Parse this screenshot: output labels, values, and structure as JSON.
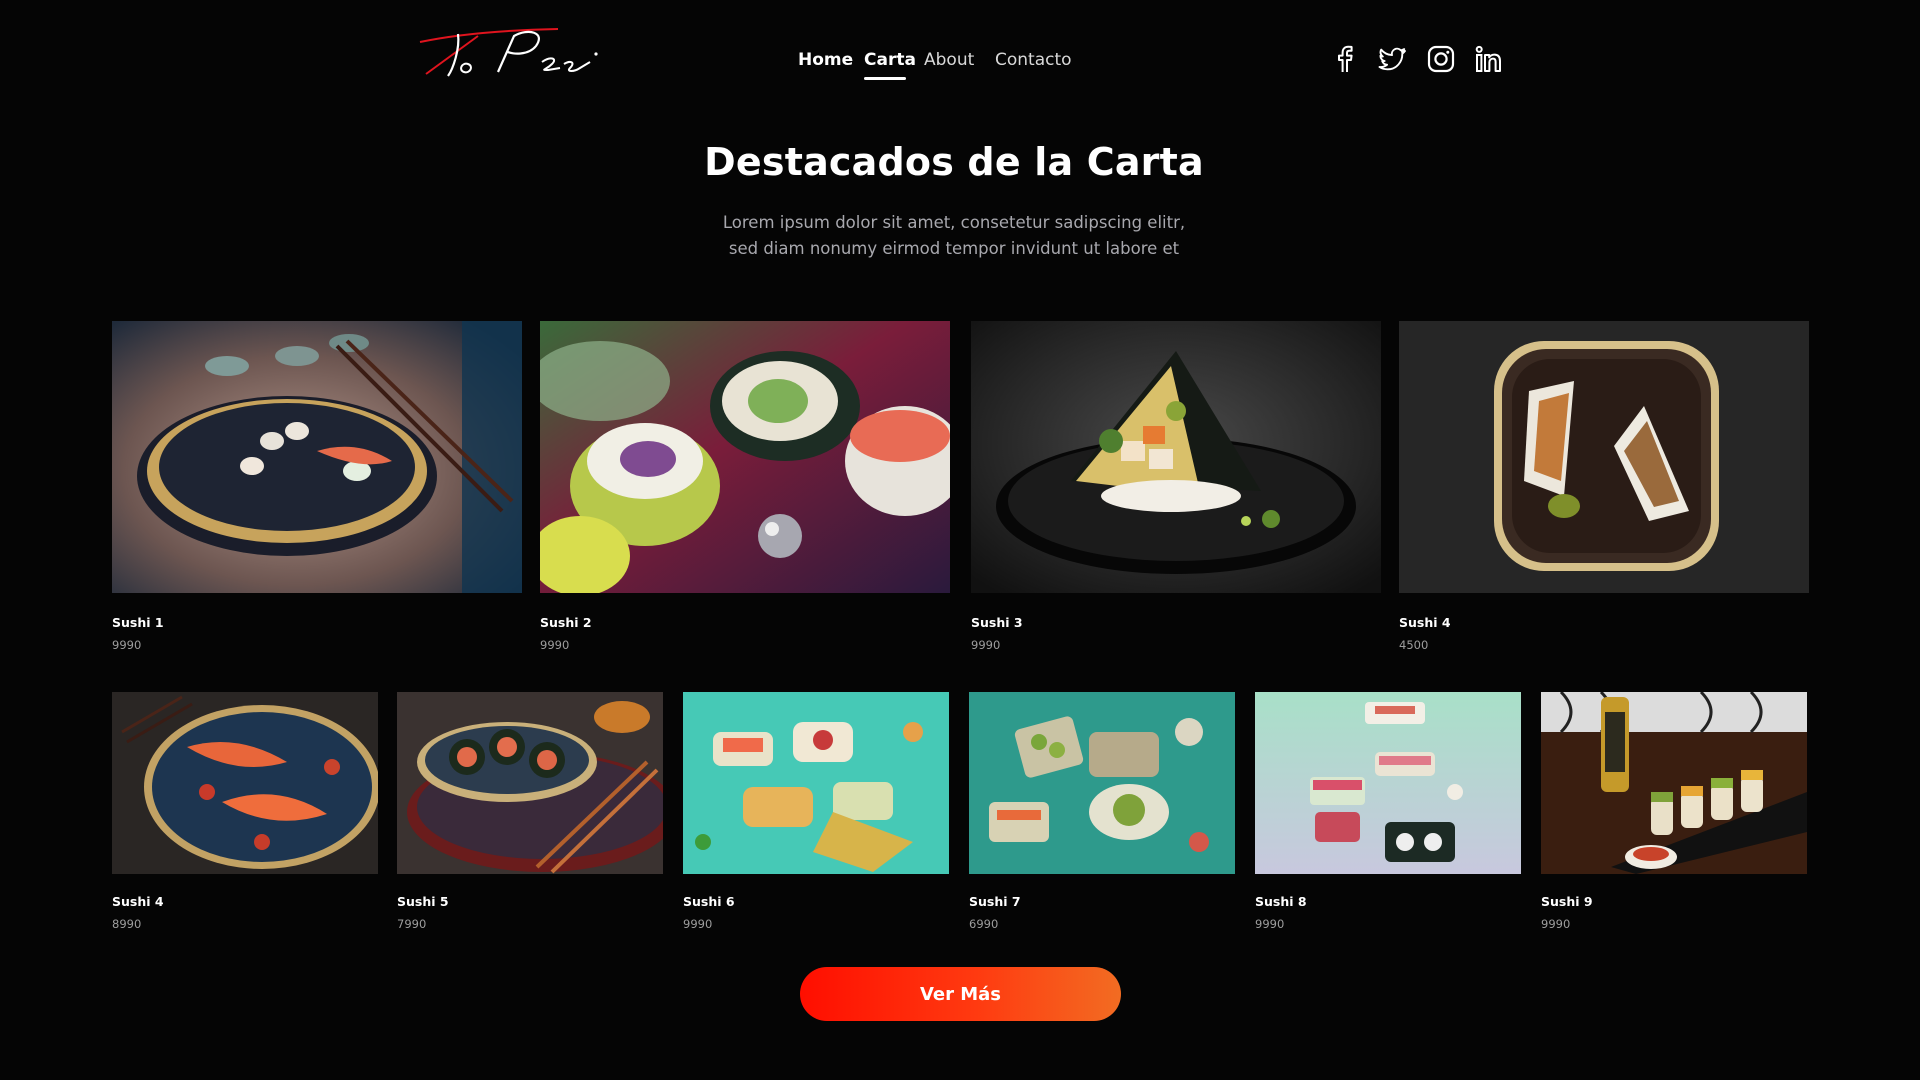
{
  "header": {
    "logo_text": "ToPei",
    "nav": [
      {
        "label": "Home"
      },
      {
        "label": "Carta",
        "active": true
      },
      {
        "label": "About"
      },
      {
        "label": "Contacto"
      }
    ],
    "socials": [
      "facebook-icon",
      "twitter-icon",
      "instagram-icon",
      "linkedin-icon"
    ]
  },
  "section": {
    "title": "Destacados de la Carta",
    "subtitle_line1": "Lorem ipsum dolor sit amet, consetetur sadipscing elitr,",
    "subtitle_line2": "sed diam nonumy eirmod tempor invidunt ut labore et"
  },
  "menu": {
    "row1": [
      {
        "name": "Sushi 1",
        "price": "9990"
      },
      {
        "name": "Sushi 2",
        "price": "9990"
      },
      {
        "name": "Sushi 3",
        "price": "9990"
      },
      {
        "name": "Sushi 4",
        "price": "4500"
      }
    ],
    "row2": [
      {
        "name": "Sushi 4",
        "price": "8990"
      },
      {
        "name": "Sushi 5",
        "price": "7990"
      },
      {
        "name": "Sushi 6",
        "price": "9990"
      },
      {
        "name": "Sushi 7",
        "price": "6990"
      },
      {
        "name": "Sushi 8",
        "price": "9990"
      },
      {
        "name": "Sushi 9",
        "price": "9990"
      }
    ]
  },
  "cta": {
    "label": "Ver Más"
  },
  "colors": {
    "background": "#050505",
    "accent_start": "#ff0e00",
    "accent_end": "#f26c22",
    "logo_red": "#e0141e",
    "muted_text": "#a8a8ae"
  }
}
